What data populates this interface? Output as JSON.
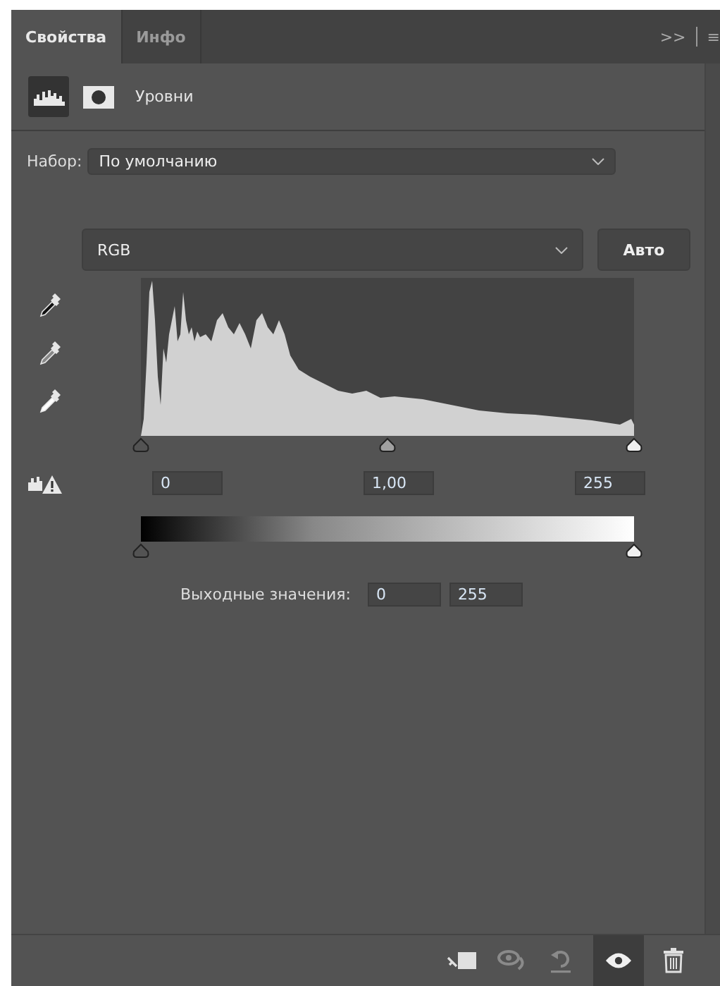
{
  "tabs": [
    {
      "label": "Свойства",
      "selected": true
    },
    {
      "label": "Инфо",
      "selected": false
    }
  ],
  "panel_menu": {
    "expand": ">>",
    "menu": "≡"
  },
  "header": {
    "title": "Уровни",
    "views": [
      {
        "kind": "histogram",
        "selected": true
      },
      {
        "kind": "mask",
        "selected": false
      }
    ]
  },
  "preset": {
    "label": "Набор:",
    "value": "По умолчанию"
  },
  "channel": {
    "value": "RGB"
  },
  "auto_button": "Авто",
  "input_values": [
    "0",
    "1,00",
    "255"
  ],
  "output": {
    "label": "Выходные значения:",
    "values": [
      "0",
      "255"
    ]
  },
  "toolbar": {
    "visibility_on": true
  }
}
